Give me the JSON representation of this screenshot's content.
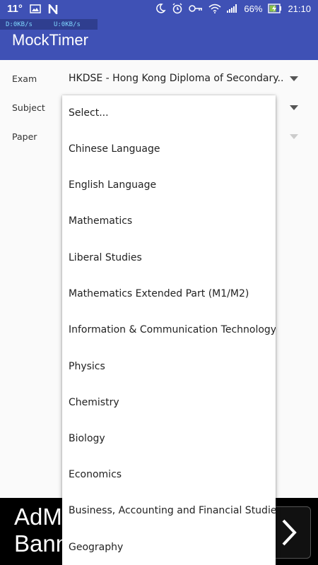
{
  "status_bar": {
    "temperature": "11°",
    "battery_percent": "66%",
    "time": "21:10",
    "download_speed": "D:0KB/s",
    "upload_speed": "U:0KB/s"
  },
  "app": {
    "title": "MockTimer"
  },
  "form": {
    "exam_label": "Exam",
    "exam_value": "HKDSE - Hong Kong Diploma of Secondary..",
    "subject_label": "Subject",
    "paper_label": "Paper"
  },
  "dropdown": {
    "items": [
      "Select...",
      "Chinese Language",
      "English Language",
      "Mathematics",
      "Liberal Studies",
      "Mathematics Extended Part (M1/M2)",
      "Information & Communication Technology",
      "Physics",
      "Chemistry",
      "Biology",
      "Economics",
      "Business, Accounting and Financial Studies",
      "Geography"
    ]
  },
  "ad": {
    "line1": "AdM",
    "line2": "Bann"
  },
  "colors": {
    "primary": "#3f51b5",
    "primary_dark": "#2f3e8f"
  }
}
